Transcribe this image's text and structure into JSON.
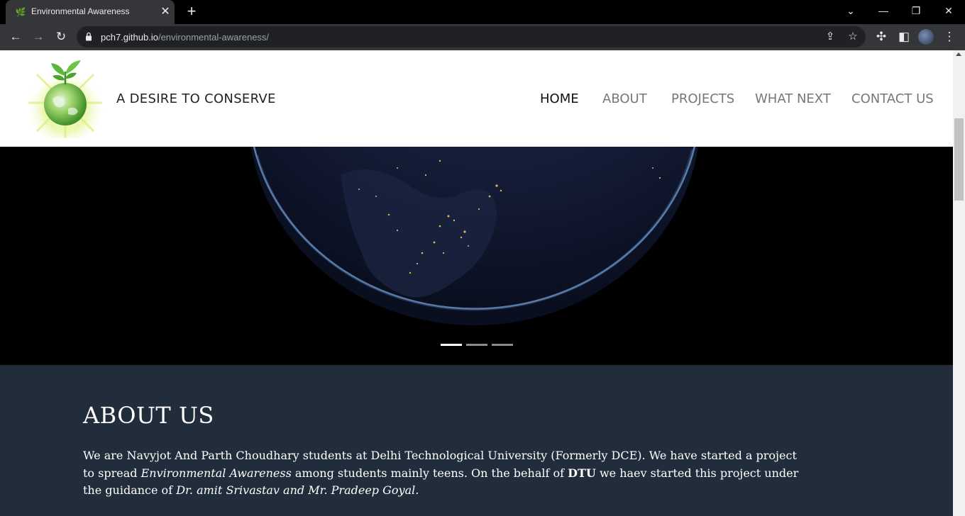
{
  "browser": {
    "tab_title": "Environmental Awareness",
    "url_host": "pch7.github.io",
    "url_path": "/environmental-awareness/"
  },
  "site": {
    "brand": "A DESIRE TO CONSERVE",
    "nav": [
      {
        "label": "HOME",
        "active": true
      },
      {
        "label": "ABOUT",
        "active": false
      },
      {
        "label": "PROJECTS",
        "active": false
      },
      {
        "label": "WHAT NEXT",
        "active": false
      },
      {
        "label": "CONTACT US",
        "active": false
      }
    ]
  },
  "carousel": {
    "active_index": 0,
    "slide_count": 3
  },
  "about": {
    "heading": "ABOUT US",
    "p1": "We are Navyjot And Parth Choudhary students at Delhi Technological University (Formerly DCE). We have started a project to spread ",
    "em1": "Environmental Awareness",
    "p2": " among students mainly teens. On the behalf of ",
    "b1": "DTU",
    "p3": " we haev started this project under the guidance of ",
    "em2": "Dr. amit Srivastav and Mr. Pradeep Goyal."
  },
  "colors": {
    "about_bg": "#222d3b",
    "hero_bg": "#000000"
  }
}
